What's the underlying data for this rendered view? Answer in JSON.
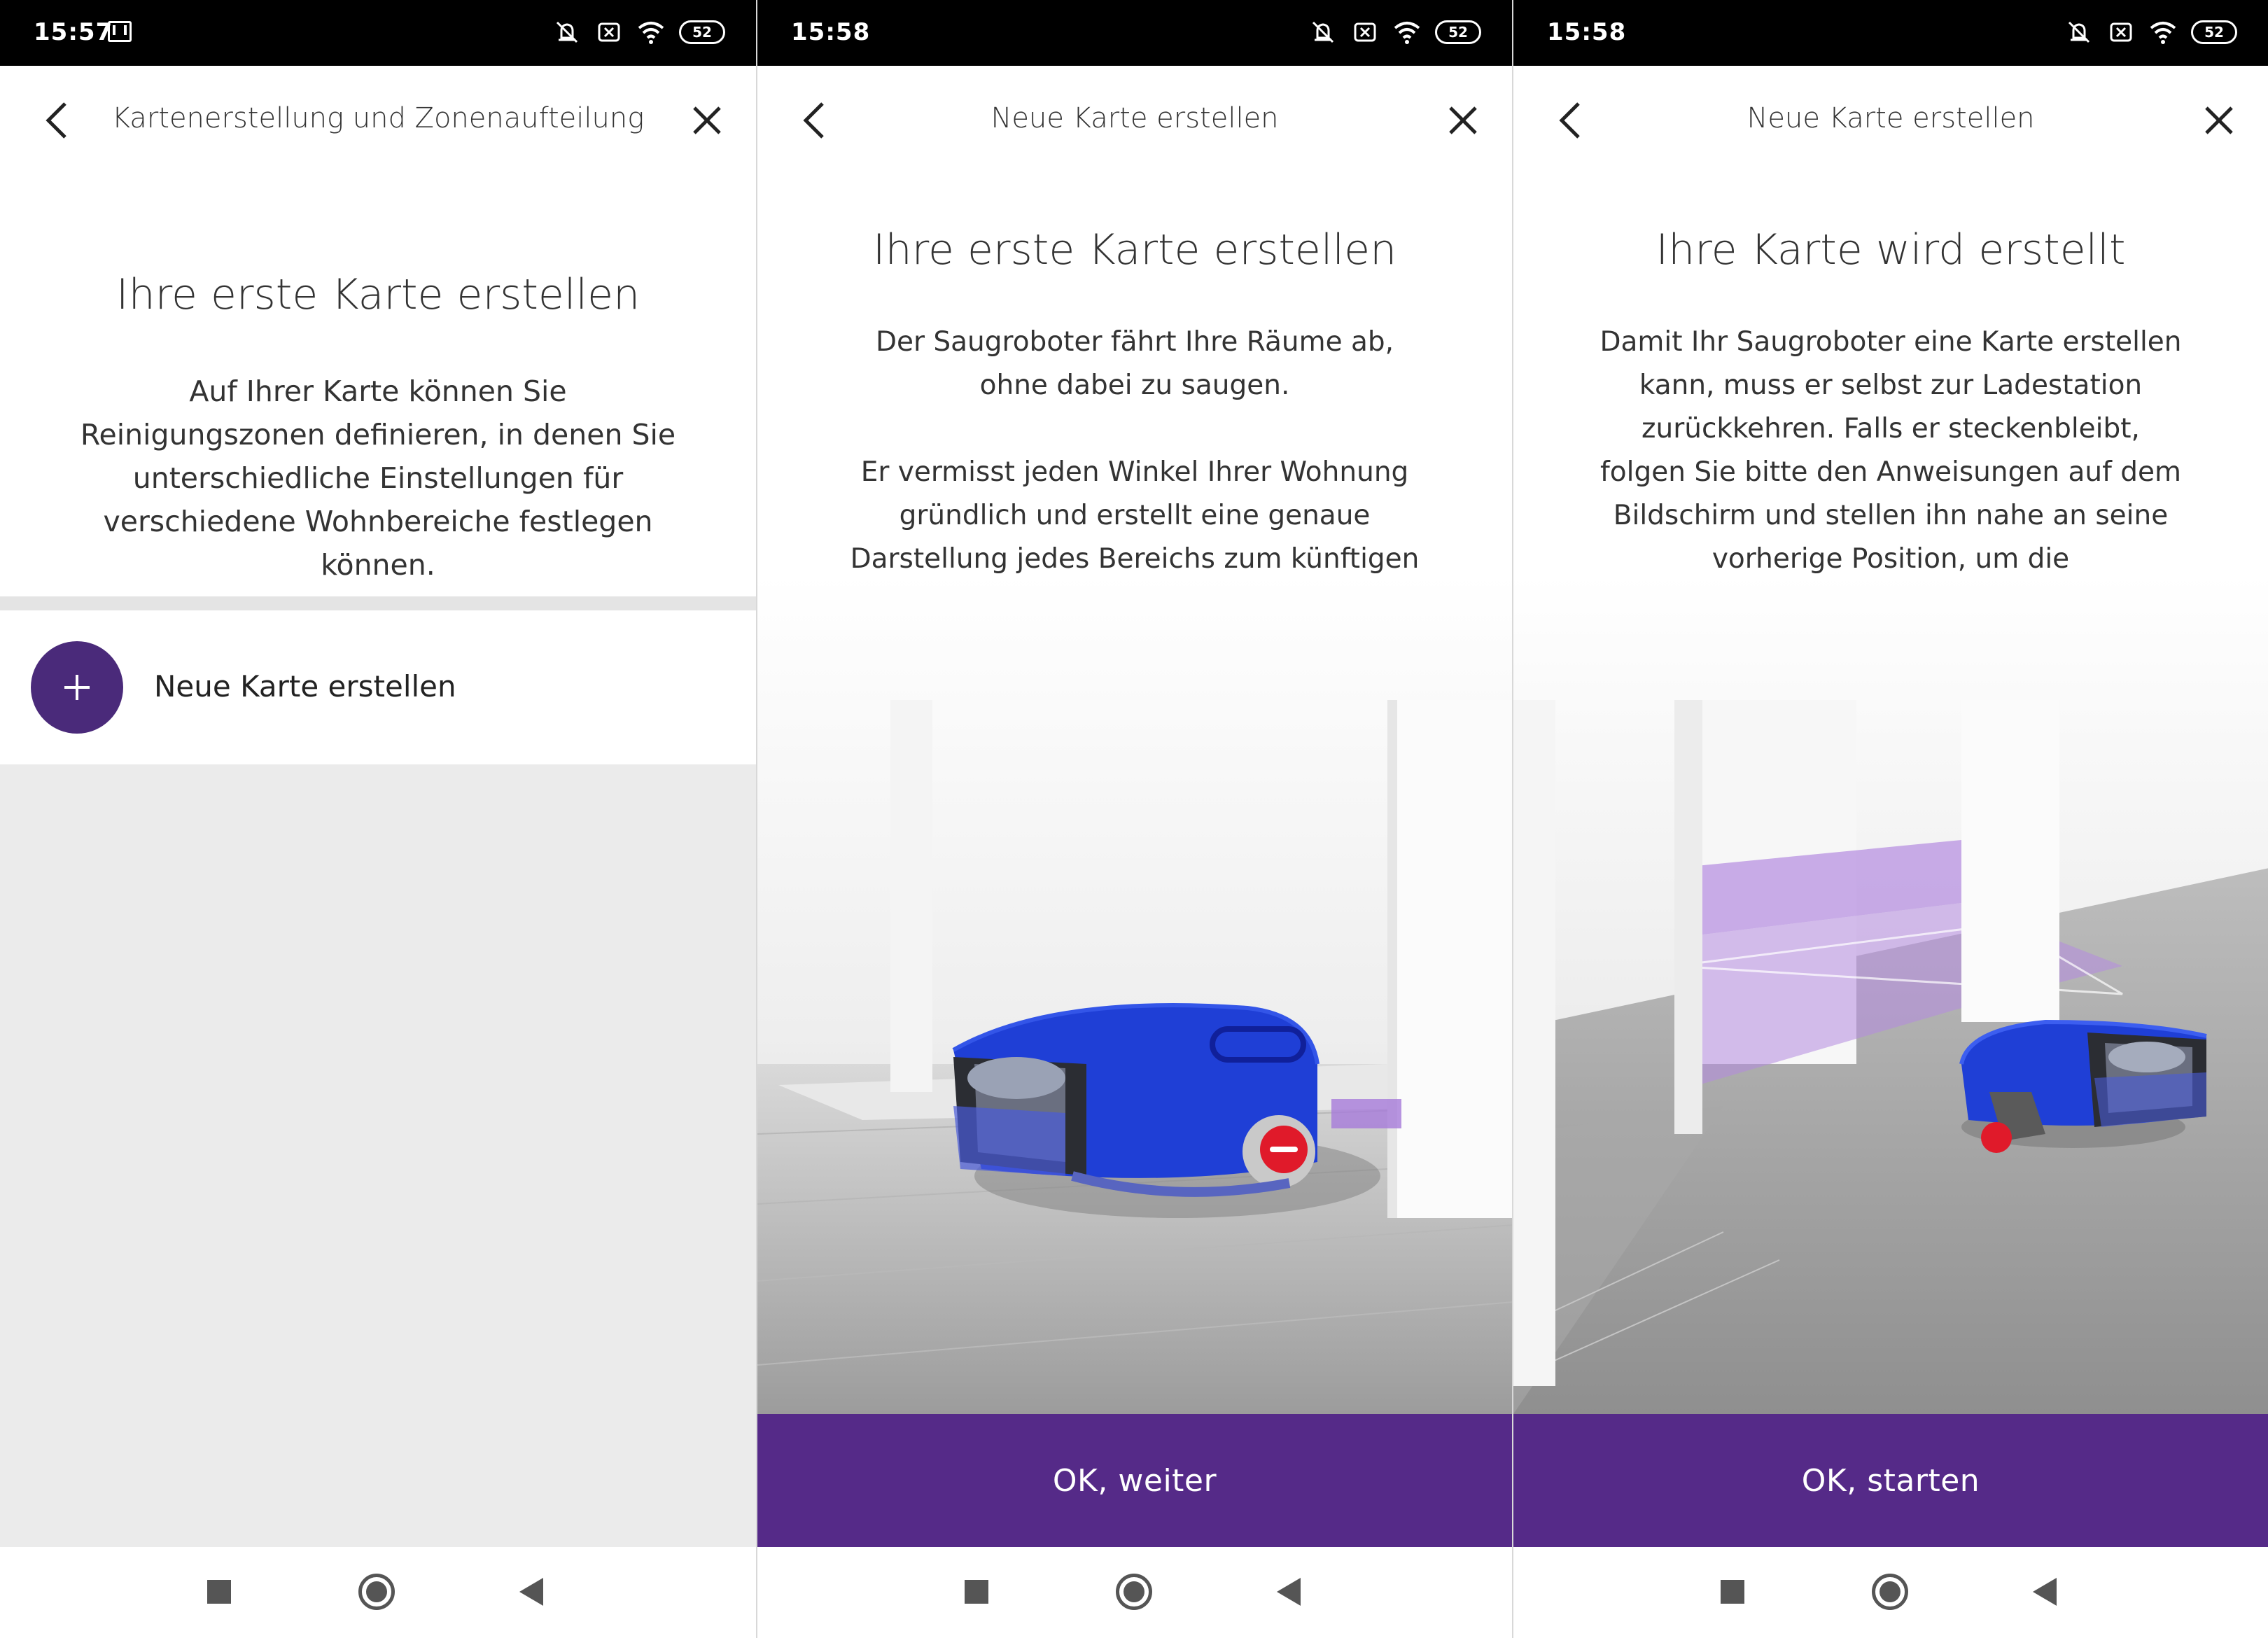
{
  "screens": [
    {
      "status": {
        "time": "15:57",
        "battery": "52"
      },
      "header": {
        "title": "Kartenerstellung und Zonenaufteilung"
      },
      "heading": "Ihre erste Karte erstellen",
      "body": "Auf Ihrer Karte können Sie Reinigungszonen definieren, in denen Sie unterschiedliche Einstellungen für verschiedene Wohnbereiche festlegen können.",
      "new_map_label": "Neue Karte erstellen"
    },
    {
      "status": {
        "time": "15:58",
        "battery": "52"
      },
      "header": {
        "title": "Neue Karte erstellen"
      },
      "heading": "Ihre erste Karte erstellen",
      "body": "Der Saugroboter fährt Ihre Räume ab, ohne dabei zu saugen.\n\nEr vermisst jeden Winkel Ihrer Wohnung gründlich und erstellt eine genaue Darstellung jedes Bereichs zum künftigen Reinigen.",
      "button_label": "OK, weiter"
    },
    {
      "status": {
        "time": "15:58",
        "battery": "52"
      },
      "header": {
        "title": "Neue Karte erstellen"
      },
      "heading": "Ihre Karte wird erstellt",
      "body": "Damit Ihr Saugroboter eine Karte erstellen kann, muss er selbst zur Ladestation zurückkehren. Falls er steckenbleibt, folgen Sie bitte den Anweisungen auf dem Bildschirm und stellen ihn nahe an seine vorherige Position, um die Kartenerstellung fortzusetzen.",
      "button_label": "OK, starten"
    }
  ],
  "icons": {
    "status": [
      "mute-icon",
      "no-sim-icon",
      "wifi-icon",
      "battery-icon"
    ],
    "header": [
      "back-arrow-icon",
      "close-icon"
    ],
    "nav": [
      "recents-square-icon",
      "home-circle-icon",
      "back-triangle-icon"
    ]
  },
  "colors": {
    "accent": "#552a88",
    "plus_circle": "#4a2a7a",
    "robot_blue": "#1f3fd6",
    "robot_red": "#e01a2a"
  }
}
